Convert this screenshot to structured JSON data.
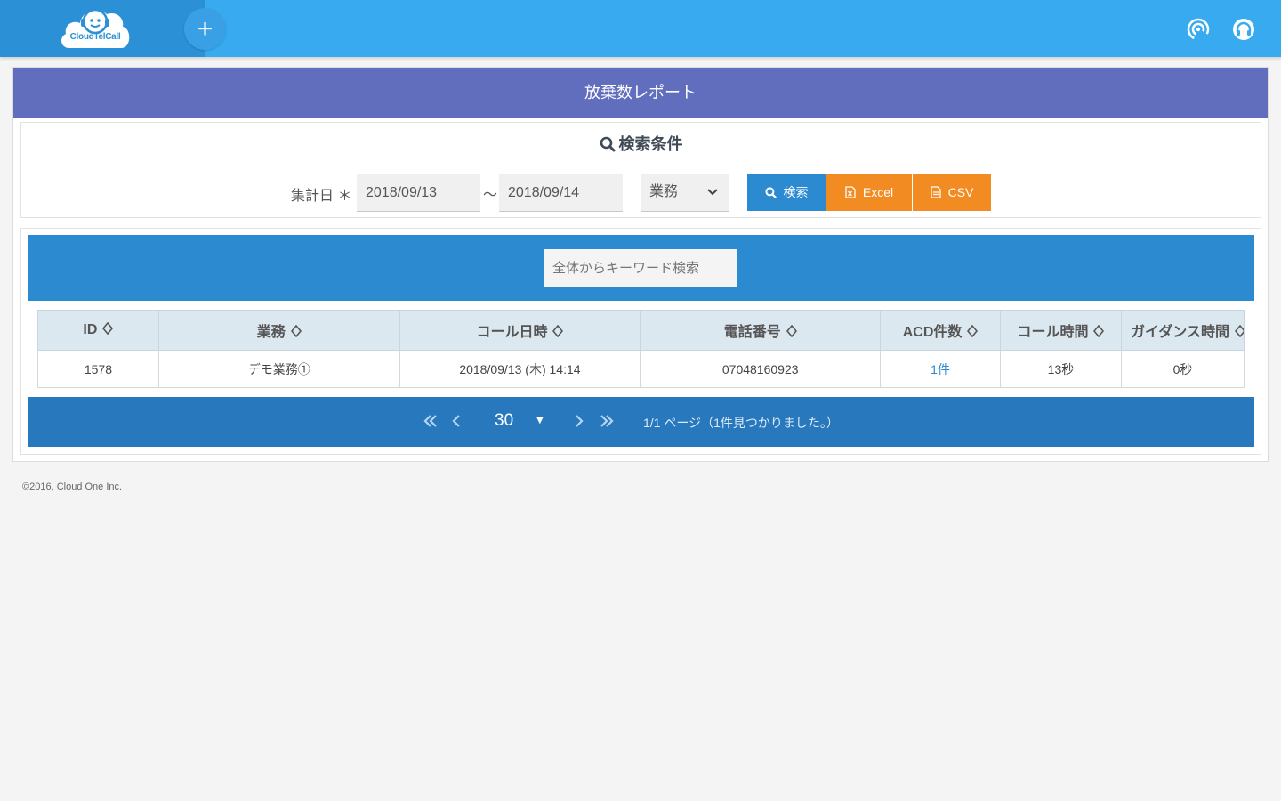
{
  "header": {
    "logo_text": "CloudTelCall",
    "add_label": "+"
  },
  "page": {
    "title": "放棄数レポート"
  },
  "search": {
    "heading": "検索条件",
    "date_label": "集計日 ＊",
    "date_from": "2018/09/13",
    "date_separator": "～",
    "date_to": "2018/09/14",
    "task_select": "業務",
    "search_button": "検索",
    "excel_button": "Excel",
    "csv_button": "CSV"
  },
  "keyword": {
    "placeholder": "全体からキーワード検索"
  },
  "table": {
    "columns": [
      "ID",
      "業務",
      "コール日時",
      "電話番号",
      "ACD件数",
      "コール時間",
      "ガイダンス時間"
    ],
    "rows": [
      [
        "1578",
        "デモ業務①",
        "2018/09/13 (木) 14:14",
        "07048160923",
        "1件",
        "13秒",
        "0秒"
      ]
    ]
  },
  "pager": {
    "page_size": "30",
    "info": "1/1 ページ（1件見つかりました。）"
  },
  "footer": {
    "copyright": "©2016, Cloud One Inc."
  },
  "colors": {
    "topbar": "#38aaef",
    "title_bar": "#616dbd",
    "primary": "#2b8ad0",
    "accent_orange": "#f28b22"
  }
}
